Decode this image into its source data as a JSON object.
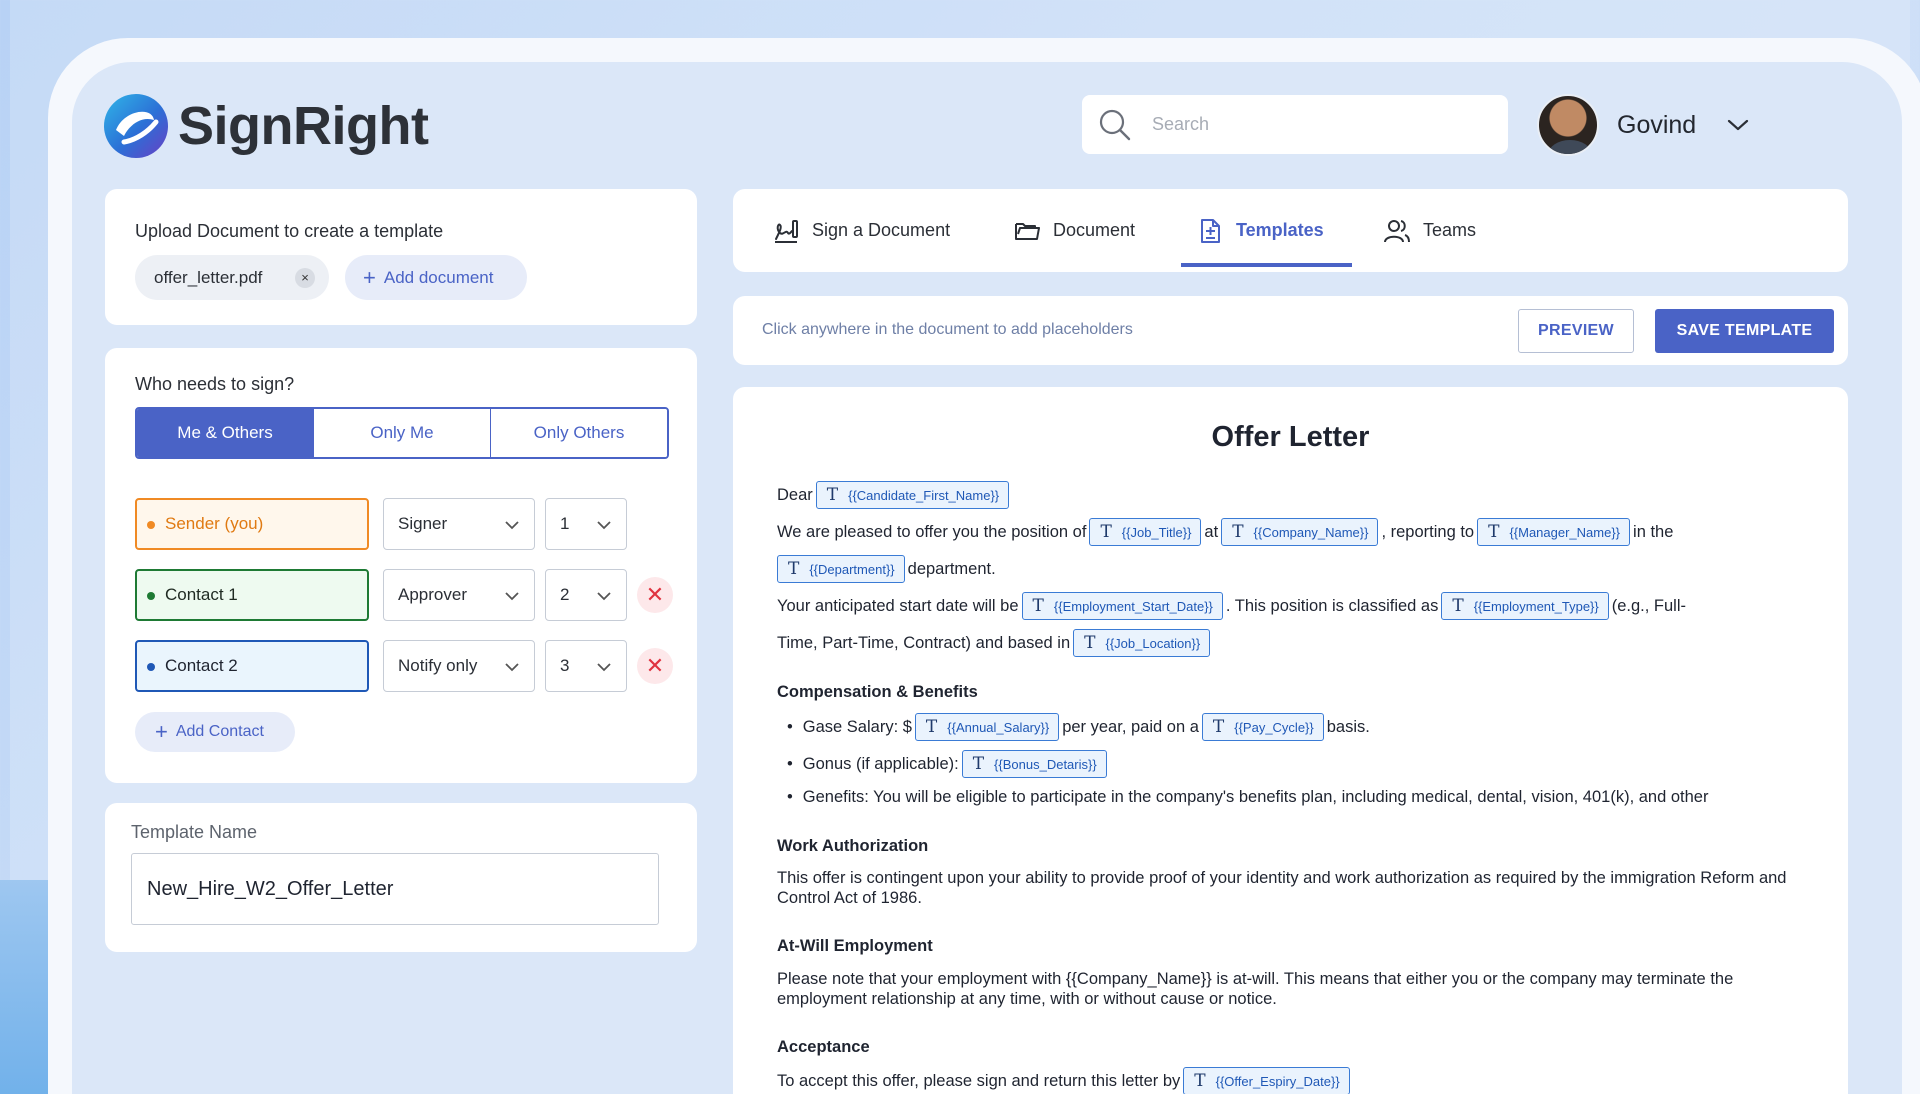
{
  "app": {
    "name": "SignRight"
  },
  "header": {
    "search_placeholder": "Search",
    "user_name": "Govind"
  },
  "upload": {
    "title": "Upload Document to create a template",
    "file_chip": "offer_letter.pdf",
    "file_remove": "×",
    "add_document": "Add document"
  },
  "signers": {
    "title": "Who needs to sign?",
    "modes": [
      "Me & Others",
      "Only Me",
      "Only Others"
    ],
    "active_mode": "Me & Others",
    "rows": [
      {
        "name": "Sender (you)",
        "role": "Signer",
        "order": "1",
        "color": "#f08a24",
        "removable": false
      },
      {
        "name": "Contact 1",
        "role": "Approver",
        "order": "2",
        "color": "#1e7a34",
        "removable": true
      },
      {
        "name": "Contact 2",
        "role": "Notify only",
        "order": "3",
        "color": "#1f58b6",
        "removable": true
      }
    ],
    "add_contact": "Add Contact",
    "remove_symbol": "✕"
  },
  "template_name": {
    "label": "Template Name",
    "value": "New_Hire_W2_Offer_Letter"
  },
  "tabs": [
    {
      "label": "Sign a Document",
      "icon": "signature-icon",
      "active": false
    },
    {
      "label": "Document",
      "icon": "folder-icon",
      "active": false
    },
    {
      "label": "Templates",
      "icon": "template-file-icon",
      "active": true
    },
    {
      "label": "Teams",
      "icon": "users-icon",
      "active": false
    }
  ],
  "toolbar": {
    "hint": "Click anywhere in the document to add placeholders",
    "preview": "PREVIEW",
    "save": "SAVE TEMPLATE"
  },
  "document": {
    "title": "Offer Letter",
    "placeholder_icon": "T",
    "dear": "Dear",
    "p1_a": "We are pleased to offer you the position of",
    "p1_b": "at",
    "p1_c": ", reporting to",
    "p1_d": "in the",
    "p1_e": "department.",
    "p2_a": "Your anticipated start date will be",
    "p2_b": ". This position is classified as",
    "p2_c": "(e.g., Full-",
    "p2_d": "Time, Part-Time, Contract) and based in",
    "placeholders": {
      "candidate": "{{Candidate_First_Name}}",
      "job_title": "{{Job_Title}}",
      "company": "{{Company_Name}}",
      "manager": "{{Manager_Name}}",
      "department": "{{Department}}",
      "start_date": "{{Employment_Start_Date}}",
      "emp_type": "{{Employment_Type}}",
      "location": "{{Job_Location}}",
      "salary": "{{Annual_Salary}}",
      "pay_cycle": "{{Pay_Cycle}}",
      "bonus": "{{Bonus_Detaris}}",
      "expiry": "{{Offer_Espiry_Date}}"
    },
    "comp_heading": "Compensation & Benefits",
    "b1_a": "Gase Salary: $",
    "b1_b": "per year, paid on a",
    "b1_c": "basis.",
    "b2_a": "Gonus (if applicable):",
    "b3": "Genefits: You will be eligible to participate in the company's benefits plan, including medical, dental, vision, 401(k), and other",
    "work_heading": "Work Authorization",
    "work_text": "This offer is contingent upon your ability to provide proof of your identity and work authorization as required by the immigration Reform and Control Act of 1986.",
    "atwill_heading": "At-Will Employment",
    "atwill_text": "Please note that your employment with {{Company_Name}} is at-will. This means that either you or the company may terminate the employment relationship at any time, with or without cause or notice.",
    "accept_heading": "Acceptance",
    "accept_text": "To accept this offer, please sign and return this letter by"
  },
  "colors": {
    "accent": "#4a63c6",
    "placeholder_border": "#3a7bd5",
    "remove_red": "#e0323f"
  }
}
